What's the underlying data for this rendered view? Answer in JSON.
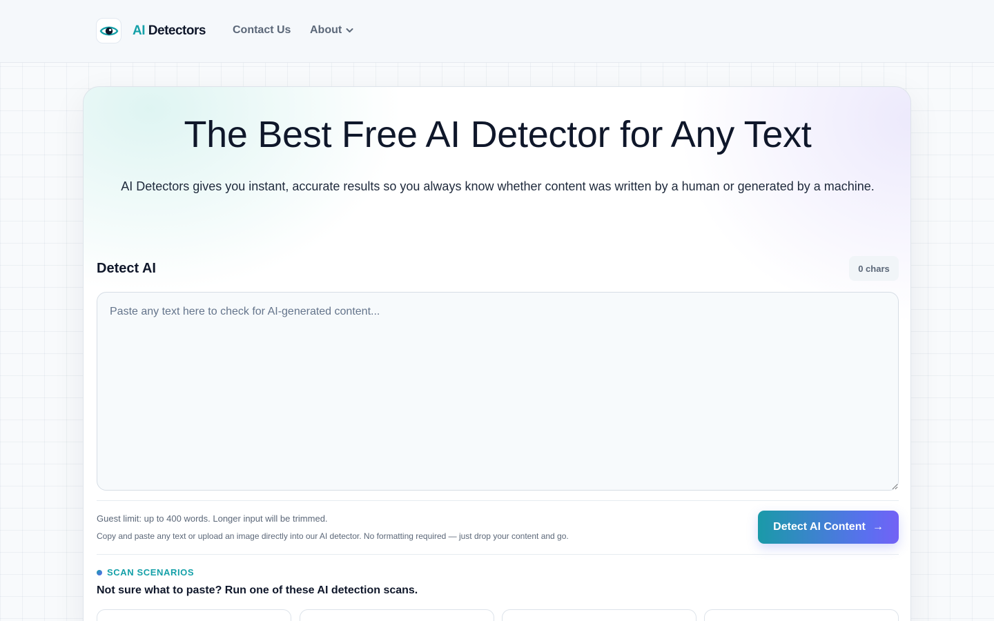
{
  "header": {
    "brand_ai": "AI",
    "brand_rest": "Detectors",
    "logo_icon": "eye-icon",
    "nav": {
      "contact_label": "Contact Us",
      "about_label": "About"
    }
  },
  "hero": {
    "title": "The Best Free AI Detector for Any Text",
    "subtitle": "AI Detectors gives you instant, accurate results so you always know whether content was written by a human or generated by a machine."
  },
  "detector": {
    "section_title": "Detect AI",
    "char_count": "0 chars",
    "input_value": "",
    "input_placeholder": "Paste any text here to check for AI-generated content...",
    "guest_limit_note": "Guest limit: up to 400 words. Longer input will be trimmed.",
    "help_note": "Copy and paste any text or upload an image directly into our AI detector. No formatting required — just drop your content and go.",
    "detect_button_label": "Detect AI Content",
    "detect_button_arrow": "→"
  },
  "scenarios": {
    "kicker": "SCAN SCENARIOS",
    "heading": "Not sure what to paste? Run one of these AI detection scans."
  },
  "colors": {
    "accent_teal": "#14a0a8",
    "accent_violet": "#7362f5",
    "text_dark": "#0f172a",
    "text_muted": "#5b6778"
  }
}
